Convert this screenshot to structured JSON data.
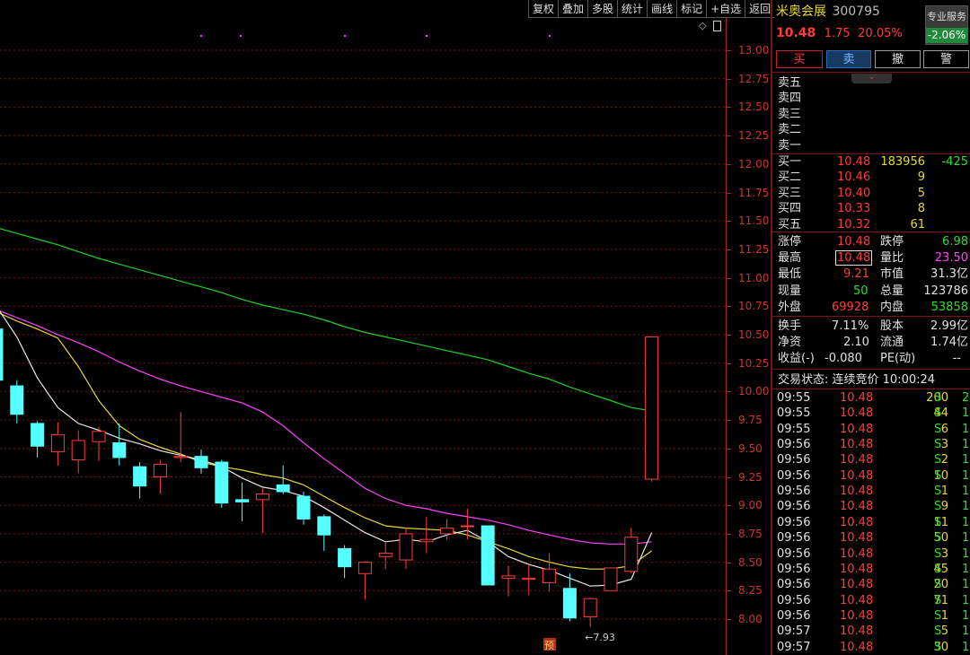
{
  "toolbar": {
    "items": [
      "复权",
      "叠加",
      "多股",
      "统计",
      "画线",
      "标记",
      "+自选",
      "返回"
    ]
  },
  "stock": {
    "name": "米奥会展",
    "code": "300795",
    "price": "10.48",
    "change": "1.75",
    "change_pct": "20.05%",
    "service_label": "专业服务",
    "service_value": "-2.06%"
  },
  "trade_buttons": [
    "买",
    "卖",
    "撤",
    "警"
  ],
  "order_book": {
    "sell": [
      {
        "label": "卖五",
        "price": "",
        "vol": ""
      },
      {
        "label": "卖四",
        "price": "",
        "vol": ""
      },
      {
        "label": "卖三",
        "price": "",
        "vol": ""
      },
      {
        "label": "卖二",
        "price": "",
        "vol": ""
      },
      {
        "label": "卖一",
        "price": "",
        "vol": ""
      }
    ],
    "buy": [
      {
        "label": "买一",
        "price": "10.48",
        "vol": "183956",
        "delta": "-425"
      },
      {
        "label": "买二",
        "price": "10.46",
        "vol": "9",
        "delta": ""
      },
      {
        "label": "买三",
        "price": "10.40",
        "vol": "5",
        "delta": ""
      },
      {
        "label": "买四",
        "price": "10.33",
        "vol": "8",
        "delta": ""
      },
      {
        "label": "买五",
        "price": "10.32",
        "vol": "61",
        "delta": ""
      }
    ]
  },
  "stats": {
    "limit_up_label": "涨停",
    "limit_up": "10.48",
    "limit_down_label": "跌停",
    "limit_down": "6.98",
    "high_label": "最高",
    "high": "10.48",
    "vol_ratio_label": "量比",
    "vol_ratio": "23.50",
    "low_label": "最低",
    "low": "9.21",
    "mkt_cap_label": "市值",
    "mkt_cap": "31.3亿",
    "cur_vol_label": "现量",
    "cur_vol": "50",
    "total_vol_label": "总量",
    "total_vol": "123786",
    "outer_label": "外盘",
    "outer": "69928",
    "inner_label": "内盘",
    "inner": "53858",
    "turnover_label": "换手",
    "turnover": "7.11%",
    "shares_label": "股本",
    "shares": "2.99亿",
    "nav_label": "净资",
    "nav": "2.10",
    "float_label": "流通",
    "float": "1.74亿",
    "eps_label": "收益(-)",
    "eps": "-0.080",
    "pe_label": "PE(动)",
    "pe": "--"
  },
  "trading_status": "交易状态: 连续竞价 10:00:24",
  "ticks": [
    {
      "time": "09:55",
      "price": "10.48",
      "vol": "200",
      "side": "S",
      "n": "2"
    },
    {
      "time": "09:55",
      "price": "10.48",
      "vol": "44",
      "side": "S",
      "n": "1"
    },
    {
      "time": "09:55",
      "price": "10.48",
      "vol": "6",
      "side": "S",
      "n": "1"
    },
    {
      "time": "09:56",
      "price": "10.48",
      "vol": "3",
      "side": "S",
      "n": "1"
    },
    {
      "time": "09:56",
      "price": "10.48",
      "vol": "2",
      "side": "S",
      "n": "1"
    },
    {
      "time": "09:56",
      "price": "10.48",
      "vol": "10",
      "side": "S",
      "n": "1"
    },
    {
      "time": "09:56",
      "price": "10.48",
      "vol": "1",
      "side": "S",
      "n": "1"
    },
    {
      "time": "09:56",
      "price": "10.48",
      "vol": "9",
      "side": "S",
      "n": "1"
    },
    {
      "time": "09:56",
      "price": "10.48",
      "vol": "11",
      "side": "S",
      "n": "1"
    },
    {
      "time": "09:56",
      "price": "10.48",
      "vol": "50",
      "side": "S",
      "n": "1"
    },
    {
      "time": "09:56",
      "price": "10.48",
      "vol": "3",
      "side": "S",
      "n": "1"
    },
    {
      "time": "09:56",
      "price": "10.48",
      "vol": "45",
      "side": "S",
      "n": "1"
    },
    {
      "time": "09:56",
      "price": "10.48",
      "vol": "20",
      "side": "S",
      "n": "1"
    },
    {
      "time": "09:56",
      "price": "10.48",
      "vol": "71",
      "side": "S",
      "n": "1"
    },
    {
      "time": "09:56",
      "price": "10.48",
      "vol": "1",
      "side": "S",
      "n": "1"
    },
    {
      "time": "09:57",
      "price": "10.48",
      "vol": "5",
      "side": "S",
      "n": "1"
    },
    {
      "time": "09:57",
      "price": "10.48",
      "vol": "30",
      "side": "S",
      "n": "1"
    }
  ],
  "chart_data": {
    "type": "candlestick",
    "y_ticks": [
      "13.00",
      "12.75",
      "12.50",
      "12.25",
      "12.00",
      "11.75",
      "11.50",
      "11.25",
      "11.00",
      "10.75",
      "10.50",
      "10.25",
      "10.00",
      "9.75",
      "9.50",
      "9.25",
      "9.00",
      "8.75",
      "8.50",
      "8.25",
      "8.00"
    ],
    "ylim": [
      7.75,
      13.25
    ],
    "low_marker": "←7.93",
    "event_label": "预",
    "colors": {
      "up": "#ff3b3b",
      "down": "#54ffff",
      "ma_short": "#e8e8e8",
      "ma_mid": "#e8d830",
      "ma_long": "#ff40ff",
      "ma_longest": "#20d020",
      "grid": "#7a1515"
    },
    "candles": [
      {
        "o": 10.55,
        "h": 10.6,
        "l": 10.05,
        "c": 10.1
      },
      {
        "o": 10.05,
        "h": 10.1,
        "l": 9.72,
        "c": 9.8
      },
      {
        "o": 9.72,
        "h": 9.74,
        "l": 9.42,
        "c": 9.52
      },
      {
        "o": 9.47,
        "h": 9.73,
        "l": 9.35,
        "c": 9.62
      },
      {
        "o": 9.4,
        "h": 9.66,
        "l": 9.28,
        "c": 9.57
      },
      {
        "o": 9.56,
        "h": 9.69,
        "l": 9.39,
        "c": 9.65
      },
      {
        "o": 9.55,
        "h": 9.72,
        "l": 9.35,
        "c": 9.42
      },
      {
        "o": 9.34,
        "h": 9.38,
        "l": 9.06,
        "c": 9.17
      },
      {
        "o": 9.25,
        "h": 9.4,
        "l": 9.1,
        "c": 9.36
      },
      {
        "o": 9.42,
        "h": 9.82,
        "l": 9.38,
        "c": 9.43
      },
      {
        "o": 9.43,
        "h": 9.49,
        "l": 9.28,
        "c": 9.33
      },
      {
        "o": 9.38,
        "h": 9.4,
        "l": 8.98,
        "c": 9.02
      },
      {
        "o": 9.05,
        "h": 9.2,
        "l": 8.86,
        "c": 9.03
      },
      {
        "o": 9.05,
        "h": 9.15,
        "l": 8.76,
        "c": 9.1
      },
      {
        "o": 9.18,
        "h": 9.35,
        "l": 9.1,
        "c": 9.12
      },
      {
        "o": 9.08,
        "h": 9.12,
        "l": 8.83,
        "c": 8.88
      },
      {
        "o": 8.9,
        "h": 8.92,
        "l": 8.6,
        "c": 8.74
      },
      {
        "o": 8.62,
        "h": 8.65,
        "l": 8.36,
        "c": 8.46
      },
      {
        "o": 8.4,
        "h": 8.51,
        "l": 8.17,
        "c": 8.5
      },
      {
        "o": 8.55,
        "h": 8.68,
        "l": 8.44,
        "c": 8.58
      },
      {
        "o": 8.52,
        "h": 8.8,
        "l": 8.44,
        "c": 8.75
      },
      {
        "o": 8.68,
        "h": 8.9,
        "l": 8.58,
        "c": 8.7
      },
      {
        "o": 8.75,
        "h": 8.88,
        "l": 8.7,
        "c": 8.8
      },
      {
        "o": 8.82,
        "h": 8.97,
        "l": 8.7,
        "c": 8.82
      },
      {
        "o": 8.82,
        "h": 8.82,
        "l": 8.3,
        "c": 8.3
      },
      {
        "o": 8.36,
        "h": 8.47,
        "l": 8.2,
        "c": 8.38
      },
      {
        "o": 8.35,
        "h": 8.48,
        "l": 8.21,
        "c": 8.36
      },
      {
        "o": 8.32,
        "h": 8.58,
        "l": 8.24,
        "c": 8.44
      },
      {
        "o": 8.27,
        "h": 8.4,
        "l": 7.98,
        "c": 8.01
      },
      {
        "o": 8.02,
        "h": 8.19,
        "l": 7.93,
        "c": 8.18
      },
      {
        "o": 8.25,
        "h": 8.4,
        "l": 8.25,
        "c": 8.45
      },
      {
        "o": 8.42,
        "h": 8.8,
        "l": 8.4,
        "c": 8.72
      },
      {
        "o": 9.23,
        "h": 10.48,
        "l": 9.21,
        "c": 10.48
      }
    ],
    "ma_short": [
      10.75,
      10.48,
      10.12,
      9.86,
      9.72,
      9.66,
      9.59,
      9.54,
      9.48,
      9.44,
      9.4,
      9.34,
      9.24,
      9.16,
      9.13,
      9.08,
      8.98,
      8.87,
      8.76,
      8.68,
      8.7,
      8.68,
      8.74,
      8.78,
      8.68,
      8.55,
      8.48,
      8.43,
      8.36,
      8.29,
      8.3,
      8.35,
      8.76
    ],
    "ma_mid": [
      10.7,
      10.62,
      10.55,
      10.47,
      10.22,
      9.92,
      9.7,
      9.58,
      9.51,
      9.45,
      9.38,
      9.34,
      9.31,
      9.27,
      9.24,
      9.18,
      9.08,
      8.98,
      8.89,
      8.82,
      8.8,
      8.79,
      8.78,
      8.74,
      8.68,
      8.62,
      8.55,
      8.5,
      8.46,
      8.44,
      8.44,
      8.47,
      8.6
    ],
    "ma_long": [
      10.72,
      10.65,
      10.58,
      10.5,
      10.43,
      10.35,
      10.26,
      10.18,
      10.11,
      10.05,
      10.0,
      9.95,
      9.9,
      9.82,
      9.7,
      9.55,
      9.41,
      9.28,
      9.15,
      9.06,
      9.0,
      8.97,
      8.93,
      8.9,
      8.87,
      8.83,
      8.78,
      8.74,
      8.7,
      8.67,
      8.66,
      8.66,
      8.68
    ],
    "ma_longest": [
      11.44,
      11.39,
      11.34,
      11.29,
      11.23,
      11.17,
      11.12,
      11.07,
      11.02,
      10.97,
      10.92,
      10.87,
      10.81,
      10.76,
      10.72,
      10.68,
      10.63,
      10.57,
      10.52,
      10.48,
      10.44,
      10.4,
      10.36,
      10.32,
      10.28,
      10.22,
      10.16,
      10.11,
      10.04,
      9.98,
      9.92,
      9.86,
      9.83
    ]
  }
}
